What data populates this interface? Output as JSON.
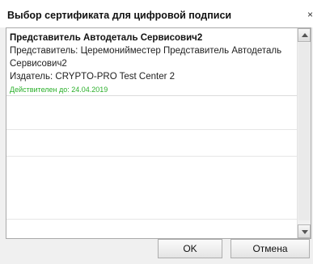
{
  "dialog": {
    "title": "Выбор сертификата для цифровой подписи",
    "close_label": "×"
  },
  "certificates": [
    {
      "name": "Представитель Автодеталь Сервисович2",
      "subject": "Представитель: Церемонийместер Представитель Автодеталь Сервисович2",
      "issuer": "Издатель: CRYPTO-PRO Test Center 2",
      "valid_until": "Действителен до: 24.04.2019"
    }
  ],
  "buttons": {
    "ok_label": "OK",
    "cancel_label": "Отмена"
  },
  "colors": {
    "valid_text": "#2bb02b",
    "dialog_bg": "#f0f0f0"
  }
}
